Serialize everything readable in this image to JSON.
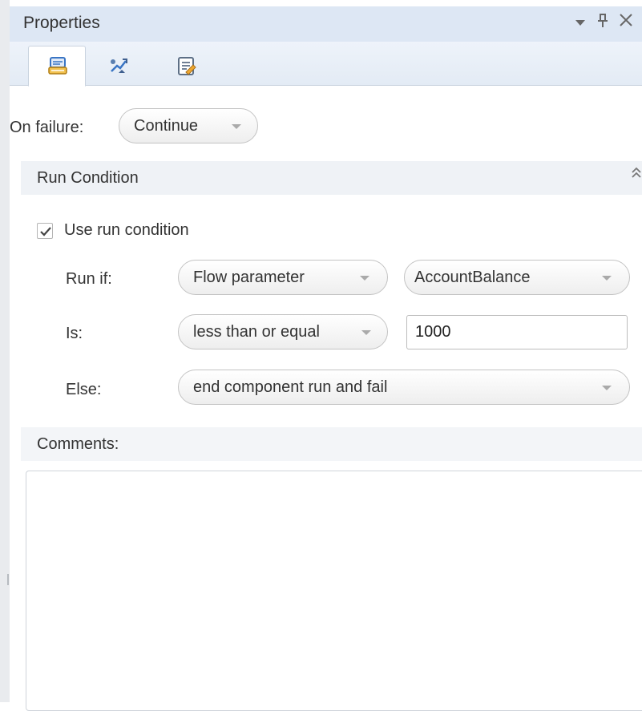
{
  "window": {
    "title": "Properties",
    "buttons": [
      "dropdown-icon",
      "pin-icon",
      "close-icon"
    ]
  },
  "tabs": [
    {
      "icon": "properties-icon",
      "active": true
    },
    {
      "icon": "parameters-icon",
      "active": false
    },
    {
      "icon": "notes-icon",
      "active": false
    }
  ],
  "on_failure": {
    "label": "On failure:",
    "value": "Continue"
  },
  "run_condition": {
    "section_title": "Run Condition",
    "use_label": "Use run condition",
    "use_checked": true,
    "run_if": {
      "label": "Run if:",
      "source": "Flow parameter",
      "parameter": "AccountBalance"
    },
    "is": {
      "label": "Is:",
      "operator": "less than or equal",
      "value": "1000"
    },
    "else": {
      "label": "Else:",
      "action": "end component run and fail"
    }
  },
  "comments": {
    "label": "Comments:",
    "text": ""
  },
  "colors": {
    "title_bar": "#dde7f4",
    "section_bar": "#eff2f6",
    "accent": "#3a75c4"
  }
}
